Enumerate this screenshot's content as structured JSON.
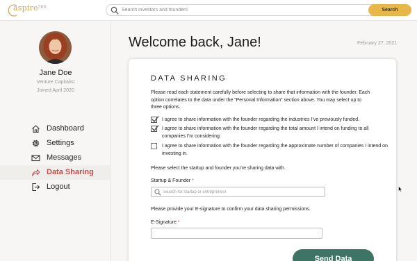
{
  "brand": {
    "name": "aspire",
    "suffix": "500",
    "color": "#d6a14a"
  },
  "search": {
    "placeholder": "Search investors and founders",
    "button_label": "Search",
    "icon": "search-icon"
  },
  "user": {
    "name": "Jane Doe",
    "role": "Venture Capitalist",
    "joined": "Joined April 2020"
  },
  "nav": {
    "items": [
      {
        "label": "Dashboard",
        "icon": "home-icon",
        "active": false
      },
      {
        "label": "Settings",
        "icon": "gear-icon",
        "active": false
      },
      {
        "label": "Messages",
        "icon": "envelope-icon",
        "active": false
      },
      {
        "label": "Data Sharing",
        "icon": "share-arrow-icon",
        "active": true
      },
      {
        "label": "Logout",
        "icon": "logout-icon",
        "active": false
      }
    ]
  },
  "main": {
    "welcome": "Welcome back, Jane!",
    "date": "February 27, 2021"
  },
  "data_sharing": {
    "title": "DATA SHARING",
    "intro": "Please read each statement carefully before selecting to share that information with the founder. Each option correlates to the data under the “Personal Information” section above. You may select up to three options.",
    "options": [
      {
        "label": "I agree to share information with the founder regarding the industries I’ve previously funded.",
        "checked": true
      },
      {
        "label": "I agree to share information with the founder regarding the total amount I intend on funding to all companies I’m considering.",
        "checked": true
      },
      {
        "label": "I agree to share information with the founder regarding the approximate number of companies I intend on investing in.",
        "checked": false
      }
    ],
    "select_prompt": "Please select the startup and founder you’re sharing data with.",
    "startup_label": "Startup & Founder",
    "startup_placeholder": "Search for startup or entrepreneur",
    "signature_prompt": "Please provide your E-signature to confirm your data sharing permissions.",
    "signature_label": "E-Signature",
    "signature_value": "",
    "required_mark": "*",
    "send_label": "Send Data"
  },
  "colors": {
    "accent": "#e9b648",
    "active_nav": "#c0504d",
    "send_button": "#3e7466"
  }
}
